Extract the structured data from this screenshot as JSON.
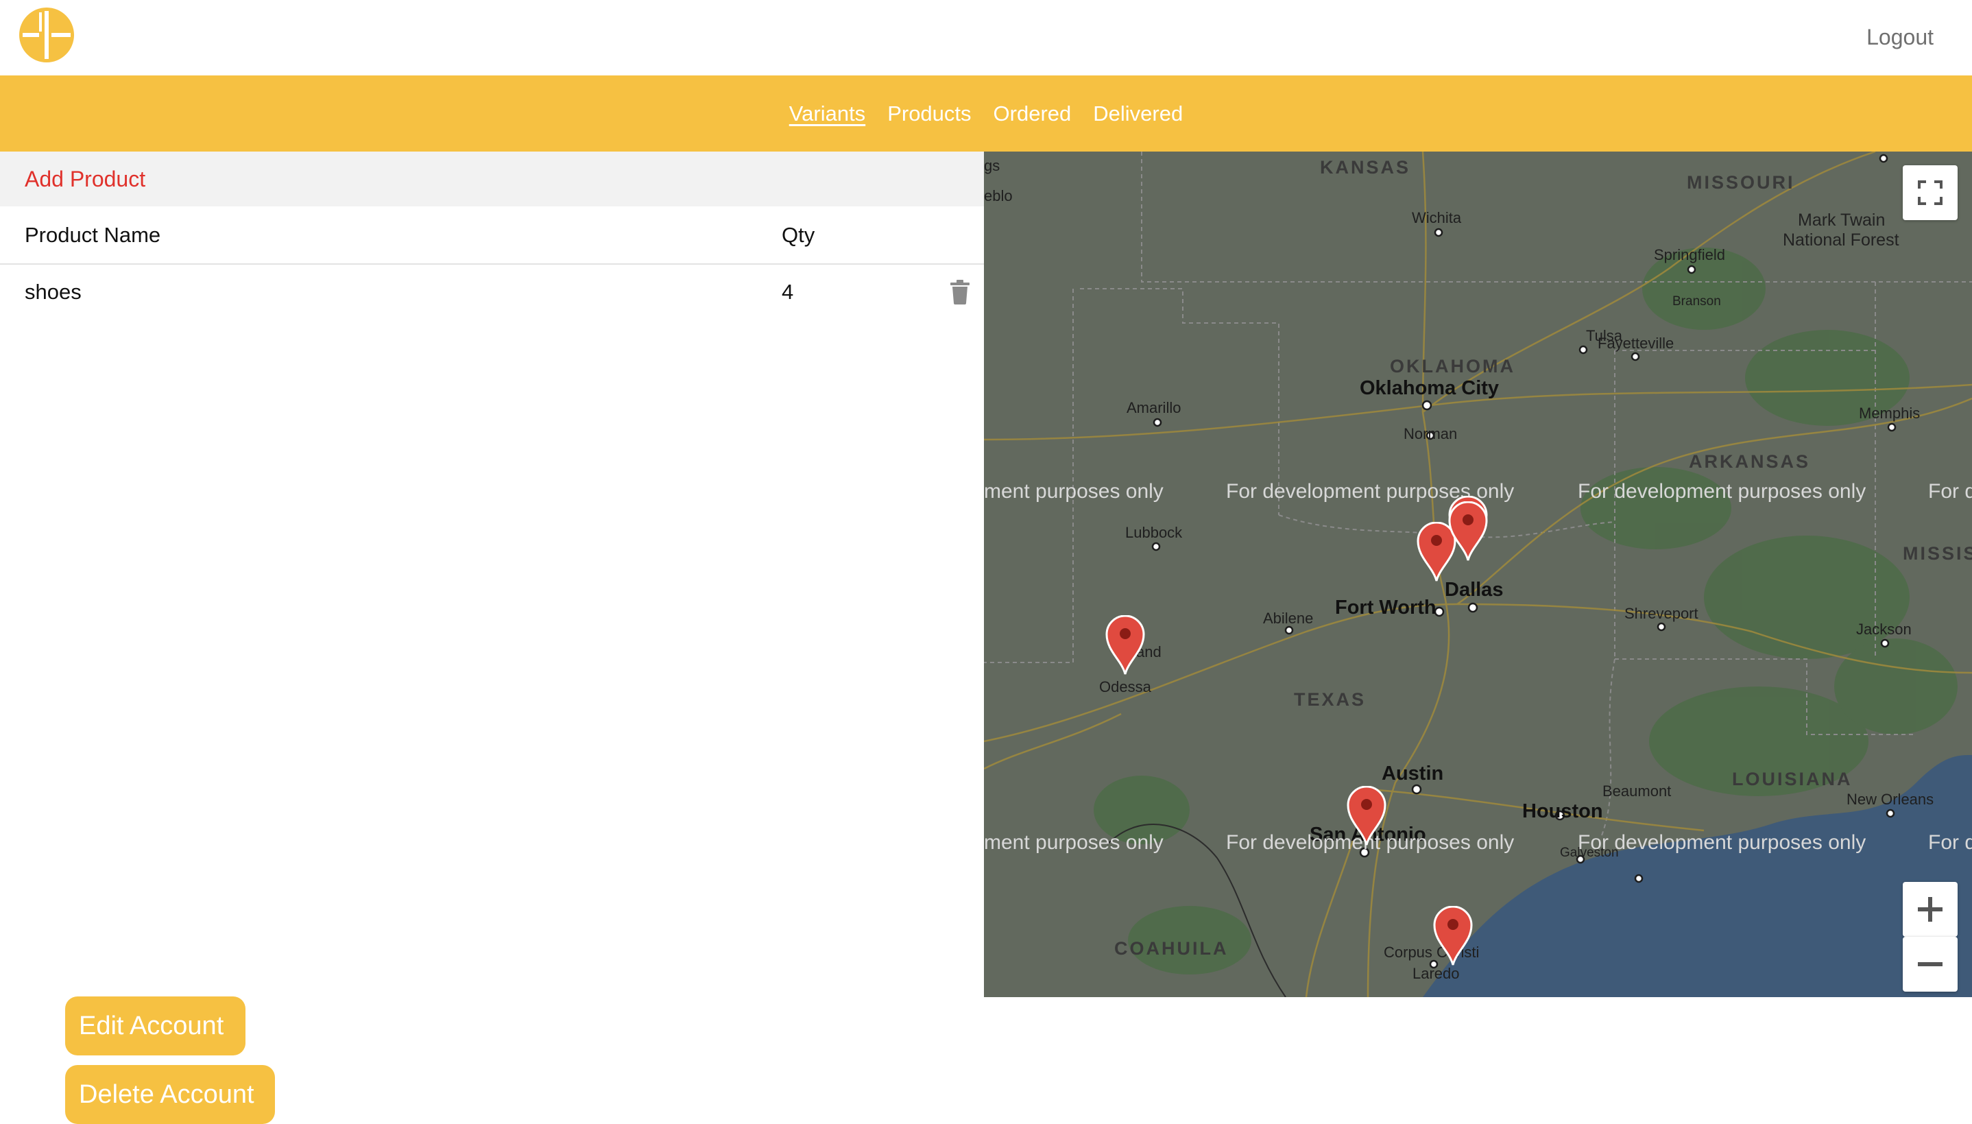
{
  "header": {
    "logout_label": "Logout",
    "brand_color": "#f6c142"
  },
  "nav": {
    "items": [
      {
        "label": "Variants",
        "active": true
      },
      {
        "label": "Products",
        "active": false
      },
      {
        "label": "Ordered",
        "active": false
      },
      {
        "label": "Delivered",
        "active": false
      }
    ]
  },
  "products": {
    "add_label": "Add Product",
    "columns": [
      "Product Name",
      "Qty"
    ],
    "rows": [
      {
        "name": "shoes",
        "qty": "4"
      }
    ],
    "delete_icon": "trash-icon"
  },
  "account": {
    "edit_label": "Edit Account",
    "delete_label": "Delete Account"
  },
  "map": {
    "watermark": "For development purposes only",
    "watermark_partial": "ment purposes only",
    "watermark_partial_right": "For d",
    "states": [
      "KANSAS",
      "MISSOURI",
      "OKLAHOMA",
      "ARKANSAS",
      "MISSISSIPPI",
      "TEXAS",
      "LOUISIANA",
      "COAHUILA"
    ],
    "parks": [
      "Mark Twain",
      "National Forest"
    ],
    "cities": [
      "Wichita",
      "Springfield",
      "Branson",
      "Tulsa",
      "Fayetteville",
      "Amarillo",
      "Norman",
      "Memphis",
      "Lubbock",
      "Abilene",
      "Shreveport",
      "Jackson",
      "Odessa",
      "Beaumont",
      "New Orleans",
      "Laredo",
      "Corpus Christi",
      "Galveston",
      "idland",
      "gs",
      "eblo"
    ],
    "major_cities": [
      "Oklahoma City",
      "Dallas",
      "Fort Worth",
      "Austin",
      "Houston",
      "San Antonio"
    ],
    "controls": {
      "zoom_in": "+",
      "zoom_out": "−"
    },
    "marker_count": 6
  }
}
